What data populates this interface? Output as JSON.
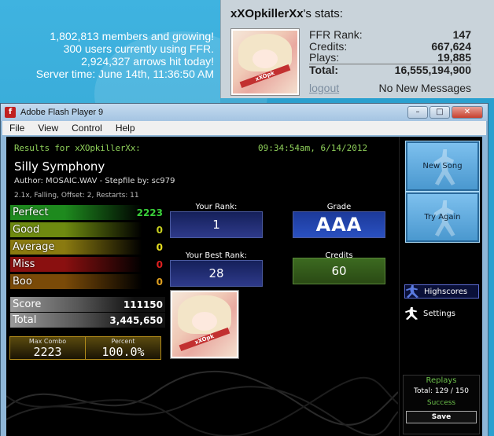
{
  "site": {
    "members_line": "1,802,813 members and growing!",
    "users_line": "300 users currently using FFR.",
    "arrows_line": "2,924,327 arrows hit today!",
    "server_time_line": "Server time: June 14th, 11:36:50 AM"
  },
  "user_panel": {
    "username": "xXOpkillerXx",
    "title_suffix": "'s stats:",
    "stats": [
      {
        "label": "FFR Rank:",
        "value": "147"
      },
      {
        "label": "Credits:",
        "value": "667,624"
      },
      {
        "label": "Plays:",
        "value": "19,885"
      }
    ],
    "total": {
      "label": "Total:",
      "value": "16,555,194,900"
    },
    "logout": "logout",
    "messages": "No New Messages",
    "avatar_band": "xXOpk"
  },
  "window": {
    "title": "Adobe Flash Player 9",
    "icon": "f",
    "buttons": {
      "minimize": "–",
      "maximize": "□",
      "close": "✕"
    },
    "menu": [
      "File",
      "View",
      "Control",
      "Help"
    ]
  },
  "results": {
    "header": "Results for xXOpkillerXx:",
    "timestamp": "09:34:54am, 6/14/2012",
    "song": "Silly Symphony",
    "author": "Author: MOSAIC.WAV   -   Stepfile by: sc979",
    "options": "2.1x, Falling, Offset: 2, Restarts: 11",
    "judgements": [
      {
        "label": "Perfect",
        "value": "2223",
        "color": "#3ad03a",
        "bar": "#1e8a1e"
      },
      {
        "label": "Good",
        "value": "0",
        "color": "#c8d020",
        "bar": "#6e8a10"
      },
      {
        "label": "Average",
        "value": "0",
        "color": "#e8e020",
        "bar": "#8a7a10"
      },
      {
        "label": "Miss",
        "value": "0",
        "color": "#e02020",
        "bar": "#8a1010"
      },
      {
        "label": "Boo",
        "value": "0",
        "color": "#e0a020",
        "bar": "#7a4a08"
      }
    ],
    "score": {
      "label": "Score",
      "value": "111150"
    },
    "total": {
      "label": "Total",
      "value": "3,445,650"
    },
    "max_combo": {
      "label": "Max Combo",
      "value": "2223"
    },
    "percent": {
      "label": "Percent",
      "value": "100.0%"
    },
    "your_rank": {
      "label": "Your Rank:",
      "value": "1"
    },
    "grade": {
      "label": "Grade",
      "value": "AAA"
    },
    "best_rank": {
      "label": "Your Best Rank:",
      "value": "28"
    },
    "credits": {
      "label": "Credits",
      "value": "60"
    }
  },
  "side": {
    "new_song": "New Song",
    "try_again": "Try Again",
    "highscores": "Highscores",
    "settings": "Settings",
    "replays": {
      "title": "Replays",
      "count": "Total: 129 / 150",
      "status": "Success",
      "save": "Save"
    }
  }
}
